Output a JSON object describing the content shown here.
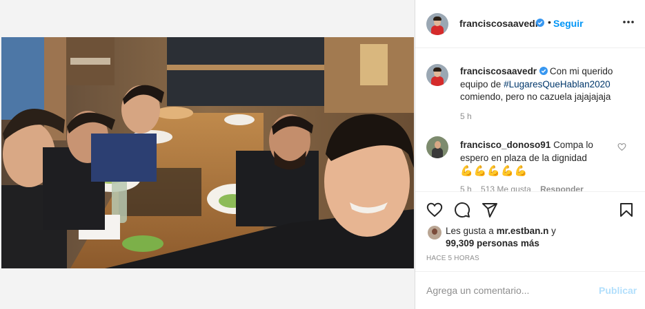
{
  "post": {
    "image_alt": "Selfie de un grupo de cinco hombres sentados a la mesa en un restaurante",
    "author": {
      "username": "franciscosaavedr",
      "verified": true
    },
    "follow_label": "Seguir",
    "header_separator": "•",
    "caption": {
      "username": "franciscosaavedr",
      "text_before": "Con mi querido equipo de ",
      "hashtag": "#LugaresQueHablan2020",
      "text_after": " comiendo, pero no cazuela jajajajaja",
      "time": "5 h"
    },
    "comments": [
      {
        "username": "francisco_donoso91",
        "text": "Compa lo espero en plaza de la dignidad",
        "emojis": "💪💪💪💪💪",
        "time": "5 h",
        "likes": "513 Me gusta",
        "reply_label": "Responder"
      }
    ],
    "likes": {
      "prefix": "Les gusta a ",
      "user": "mr.estban.n",
      "conj": " y",
      "count": "99,309 personas más"
    },
    "timestamp": "HACE 5 HORAS",
    "add_comment": {
      "placeholder": "Agrega un comentario...",
      "publish_label": "Publicar"
    }
  },
  "icons": [
    "more-options-icon",
    "verified-badge-icon",
    "heart-icon",
    "comment-icon",
    "share-icon",
    "bookmark-icon"
  ],
  "colors": {
    "link": "#0095f6",
    "hashtag": "#00376b",
    "muted": "#8e8e8e",
    "publish_disabled": "#b2dffc",
    "verified": "#3897f0"
  }
}
